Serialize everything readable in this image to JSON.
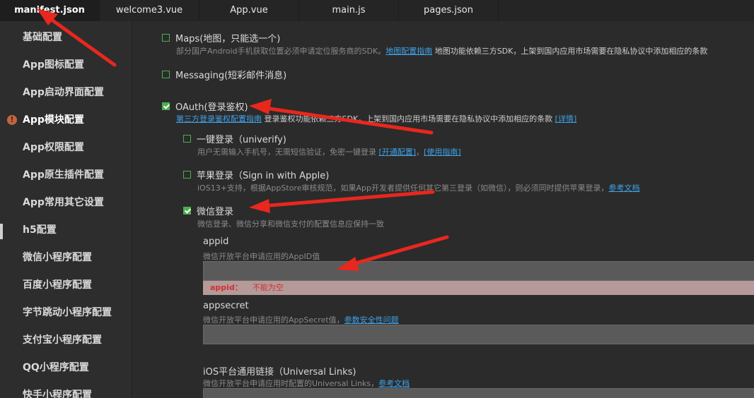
{
  "tabs": [
    {
      "label": "manifest.json",
      "active": true
    },
    {
      "label": "welcome3.vue",
      "active": false
    },
    {
      "label": "App.vue",
      "active": false
    },
    {
      "label": "main.js",
      "active": false
    },
    {
      "label": "pages.json",
      "active": false
    }
  ],
  "sidebar": {
    "items": [
      {
        "label": "基础配置"
      },
      {
        "label": "App图标配置"
      },
      {
        "label": "App启动界面配置"
      },
      {
        "label": "App模块配置"
      },
      {
        "label": "App权限配置"
      },
      {
        "label": "App原生插件配置"
      },
      {
        "label": "App常用其它设置"
      },
      {
        "label": "h5配置"
      },
      {
        "label": "微信小程序配置"
      },
      {
        "label": "百度小程序配置"
      },
      {
        "label": "字节跳动小程序配置"
      },
      {
        "label": "支付宝小程序配置"
      },
      {
        "label": "QQ小程序配置"
      },
      {
        "label": "快手小程序配置"
      }
    ],
    "warning_glyph": "!"
  },
  "main": {
    "maps": {
      "label": "Maps(地图，只能选一个)",
      "checked": false,
      "desc_pre": "部分国产Android手机获取位置必须申请定位服务商的SDK。",
      "desc_link": "地图配置指南",
      "desc_post": " 地图功能依赖三方SDK，上架到国内应用市场需要在隐私协议中添加相应的条款"
    },
    "messaging": {
      "label": "Messaging(短彩邮件消息)",
      "checked": false
    },
    "oauth": {
      "label": "OAuth(登录鉴权)",
      "checked": true,
      "desc_link1": "第三方登录鉴权配置指南",
      "desc_post": " 登录鉴权功能依赖三方SDK，上架到国内应用市场需要在隐私协议中添加相应的条款 ",
      "desc_link2": "[详情]"
    },
    "univerify": {
      "label": "一键登录（univerify)",
      "checked": false,
      "desc_pre": "用户无需输入手机号，无需短信验证，免密一键登录 ",
      "link1": "[开通配置]",
      "sep": "，",
      "link2": "[使用指南]"
    },
    "apple": {
      "label": "苹果登录（Sign in with Apple)",
      "checked": false,
      "desc_pre": "iOS13+支持，根据AppStore审核规范，如果App开发者提供任何其它第三登录（如微信），则必须同时提供苹果登录，",
      "link": "参考文档"
    },
    "weixin": {
      "label": "微信登录",
      "checked": true,
      "desc": "微信登录、微信分享和微信支付的配置信息应保持一致"
    },
    "appid": {
      "title": "appid",
      "desc": "微信开放平台申请应用的AppID值",
      "value": "",
      "error_key": "appid：",
      "error_msg": "不能为空"
    },
    "appsecret": {
      "title": "appsecret",
      "desc_pre": "微信开放平台申请应用的AppSecret值，",
      "link": "参数安全性问题",
      "value": ""
    },
    "universal_links": {
      "title": "iOS平台通用链接（Universal Links)",
      "desc_pre": "微信开放平台申请应用时配置的Universal Links，",
      "link": "参考文档",
      "value": ""
    }
  },
  "colors": {
    "accent_green": "#4caf50",
    "link_blue": "#3fa2e8",
    "error_red": "#d33030",
    "arrow_red": "#e8271e"
  }
}
